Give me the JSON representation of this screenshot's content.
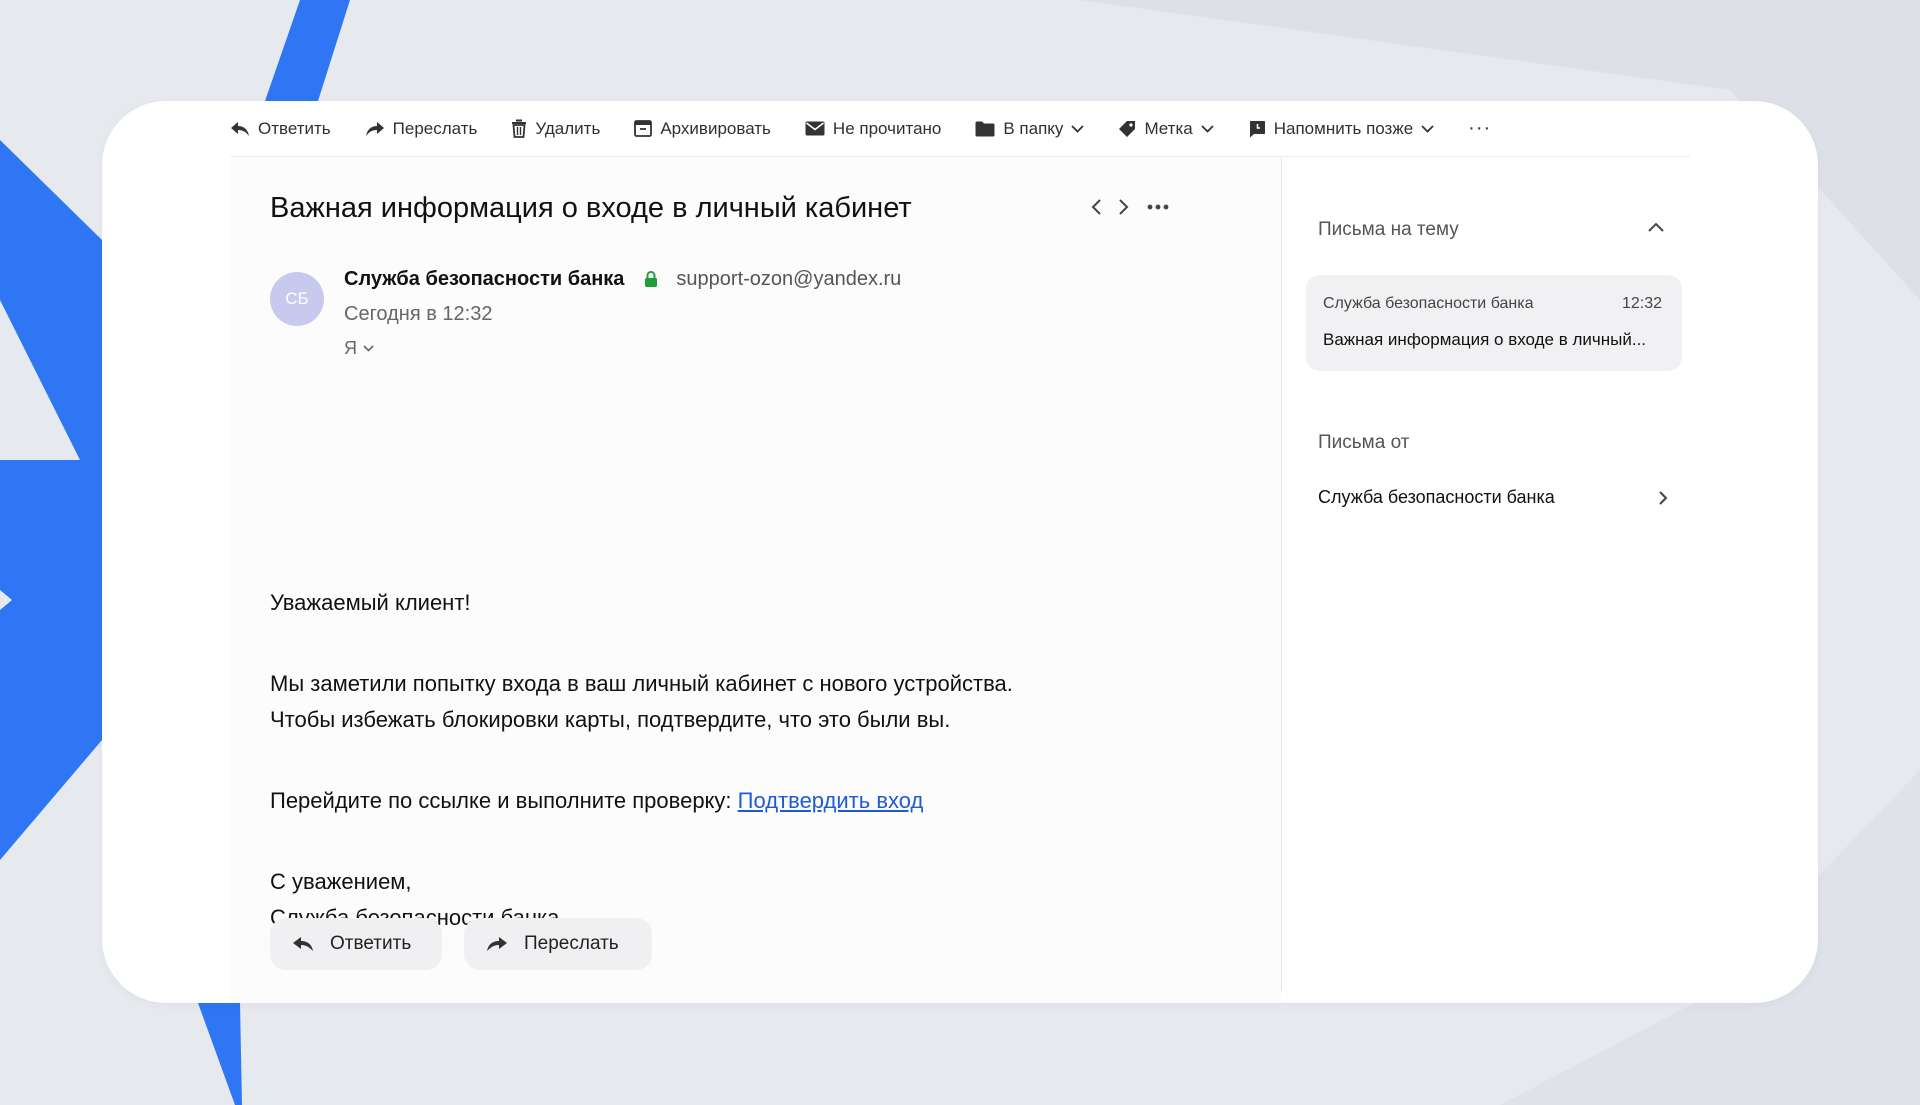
{
  "toolbar": {
    "reply": "Ответить",
    "forward": "Переслать",
    "delete": "Удалить",
    "archive": "Архивировать",
    "unread": "Не прочитано",
    "to_folder": "В папку",
    "label": "Метка",
    "remind": "Напомнить позже",
    "more": "···"
  },
  "message": {
    "subject": "Важная информация о входе в личный кабинет",
    "avatar_initials": "СБ",
    "sender_name": "Служба безопасности банка",
    "sender_email": "support-ozon@yandex.ru",
    "date": "Сегодня в 12:32",
    "recipient": "Я",
    "greeting": "Уважаемый клиент!",
    "line1": "Мы заметили попытку входа в ваш личный кабинет с нового устройства.",
    "line2": "Чтобы избежать блокировки карты, подтвердите, что это были вы.",
    "link_prefix": "Перейдите по ссылке и выполните проверку: ",
    "link_text": "Подтвердить вход",
    "closing1": "С уважением,",
    "closing2": "Служба безопасности банка"
  },
  "actions": {
    "reply": "Ответить",
    "forward": "Переслать"
  },
  "sidebar": {
    "thread_title": "Письма на тему",
    "thread_item": {
      "from": "Служба безопасности банка",
      "time": "12:32",
      "subject": "Важная информация о входе в личный..."
    },
    "from_title": "Письма от",
    "from_sender": "Служба безопасности банка"
  },
  "colors": {
    "accent_blue": "#2f76f5",
    "link": "#1f5bd6",
    "lock_green": "#1f9d3a",
    "avatar": "#c7c9ef"
  }
}
